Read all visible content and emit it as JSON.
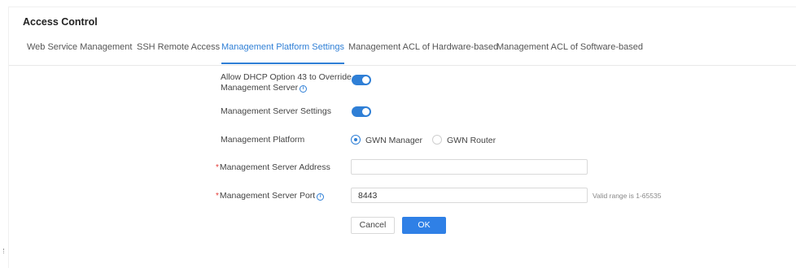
{
  "page": {
    "title": "Access Control"
  },
  "tabs": [
    {
      "label": "Web Service Management"
    },
    {
      "label": "SSH Remote Access"
    },
    {
      "label": "Management Platform Settings",
      "active": true
    },
    {
      "label": "Management ACL of Hardware-based"
    },
    {
      "label": "Management ACL of Software-based"
    }
  ],
  "form": {
    "dhcp_option_label_line1": "Allow DHCP Option 43 to Override",
    "dhcp_option_label_line2": "Management Server",
    "dhcp_option_enabled": true,
    "server_settings_label": "Management Server Settings",
    "server_settings_enabled": true,
    "platform_label": "Management Platform",
    "platform_options": [
      {
        "label": "GWN Manager",
        "checked": true
      },
      {
        "label": "GWN Router",
        "checked": false
      }
    ],
    "server_address_label": "Management Server Address",
    "server_address_value": "",
    "server_port_label": "Management Server Port",
    "server_port_value": "8443",
    "server_port_hint": "Valid range is 1-65535",
    "required_marker": "*"
  },
  "actions": {
    "cancel_label": "Cancel",
    "ok_label": "OK"
  },
  "colors": {
    "accent": "#2f7fd6",
    "required": "#e53935"
  },
  "icons": {
    "info": "info-icon"
  }
}
